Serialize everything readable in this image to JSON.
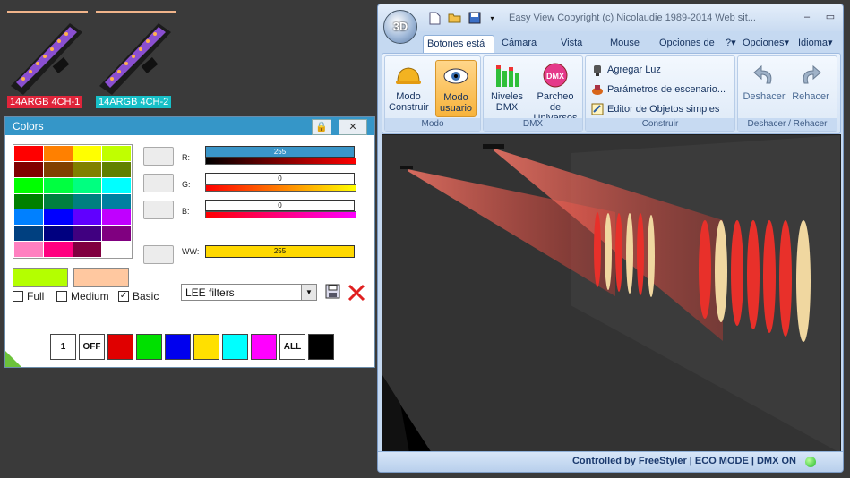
{
  "fixtures": [
    {
      "label": "14ARGB 4CH-1"
    },
    {
      "label": "14ARGB 4CH-2"
    }
  ],
  "colors_window": {
    "title": "Colors",
    "lock_icon": "lock-icon",
    "close_label": "✕",
    "palette": [
      "#ff0000",
      "#ff8000",
      "#ffff00",
      "#c0ff00",
      "#800000",
      "#804000",
      "#808000",
      "#608000",
      "#00ff00",
      "#00ff40",
      "#00ff80",
      "#00ffff",
      "#008000",
      "#008040",
      "#008080",
      "#0080a0",
      "#0080ff",
      "#0000ff",
      "#6000ff",
      "#c000ff",
      "#004080",
      "#000080",
      "#400080",
      "#800080",
      "#ff80c0",
      "#ff0080",
      "#800040",
      "#ffffff"
    ],
    "swatch_current": "#b4ff00",
    "swatch_previous": "#ffc8a0",
    "checks": [
      {
        "label": "Full",
        "checked": false
      },
      {
        "label": "Medium",
        "checked": false
      },
      {
        "label": "Basic",
        "checked": true
      }
    ],
    "sliders": [
      {
        "label": "R:",
        "value": "255",
        "color": "#3a95c8"
      },
      {
        "label": "G:",
        "value": "0",
        "color": "#ffffff"
      },
      {
        "label": "B:",
        "value": "0",
        "color": "#ffffff"
      },
      {
        "label": "WW:",
        "value": "255",
        "color": "#ffd800"
      }
    ],
    "filter_select": "LEE filters",
    "quick_buttons": [
      {
        "label": "1",
        "color": "#ffffff"
      },
      {
        "label": "OFF",
        "color": "#ffffff"
      },
      {
        "label": "",
        "color": "#e00000"
      },
      {
        "label": "",
        "color": "#00e000"
      },
      {
        "label": "",
        "color": "#0000ee"
      },
      {
        "label": "",
        "color": "#ffe000"
      },
      {
        "label": "",
        "color": "#00ffff"
      },
      {
        "label": "",
        "color": "#ff00ff"
      },
      {
        "label": "ALL",
        "color": "#ffffff"
      },
      {
        "label": "",
        "color": "#000000"
      }
    ]
  },
  "app": {
    "logo": "3D",
    "title": "Easy View   Copyright (c) Nicolaudie 1989-2014   Web sit...",
    "tabs": [
      "Botones está",
      "Cámara",
      "Vista",
      "Mouse",
      "Opciones de"
    ],
    "help_label": "?",
    "opciones_label": "Opciones",
    "idioma_label": "Idioma",
    "ribbon": {
      "modo": {
        "label": "Modo",
        "construir": "Modo Construir",
        "usuario": "Modo usuario"
      },
      "dmx": {
        "label": "DMX",
        "niveles": "Niveles DMX",
        "parcheo": "Parcheo de Universos"
      },
      "construir": {
        "label": "Construir",
        "items": [
          "Agregar Luz",
          "Parámetros de escenario...",
          "Editor de Objetos simples"
        ]
      },
      "deshacer": {
        "label": "Deshacer / Rehacer",
        "deshacer": "Deshacer",
        "rehacer": "Rehacer"
      }
    },
    "status": "Controlled by FreeStyler  |  ECO MODE  |  DMX ON"
  }
}
